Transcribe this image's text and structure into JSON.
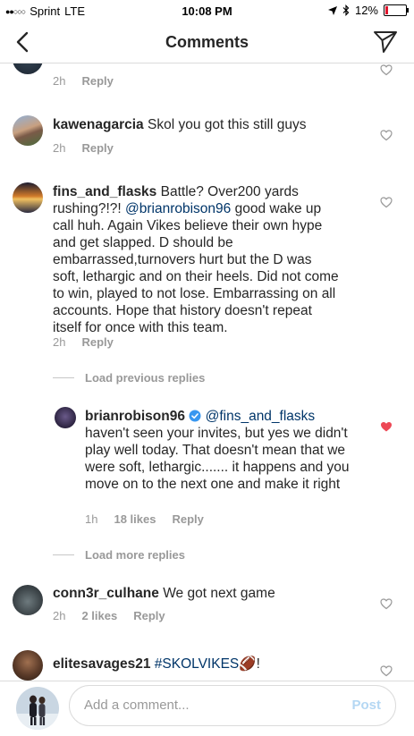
{
  "status_bar": {
    "signal": "●●○○○",
    "carrier": "Sprint",
    "network": "LTE",
    "time": "10:08 PM",
    "battery": "12%",
    "battery_color": "#e0142c"
  },
  "header": {
    "title": "Comments",
    "back_icon": "chevron-left-icon",
    "share_icon": "paper-plane-icon"
  },
  "comments": {
    "partial": {
      "time": "2h",
      "reply": "Reply"
    },
    "c1": {
      "username": "kawenagarcia",
      "text": "Skol you got this still guys",
      "time": "2h",
      "reply": "Reply"
    },
    "c2": {
      "username": "fins_and_flasks",
      "text_pre": "Battle? Over200 yards rushing?!?! ",
      "mention": "@brianrobison96",
      "text_post": " good wake up call huh. Again Vikes believe their own hype and get slapped. D should be embarrassed,turnovers hurt but the D was soft, lethargic and on their heels. Did not come to win, played to not lose. Embarrassing on all accounts. Hope that history doesn't repeat itself for once with this team.",
      "time": "2h",
      "reply": "Reply"
    },
    "load_previous": "Load previous replies",
    "reply1": {
      "username": "brianrobison96",
      "mention": "@fins_and_flasks",
      "text": " haven't seen your invites, but yes we didn't play well today. That doesn't mean that we were soft, lethargic....... it happens and you move on to the next one and make it right",
      "time": "1h",
      "likes": "18 likes",
      "reply": "Reply",
      "liked": true
    },
    "load_more": "Load more replies",
    "c3": {
      "username": "conn3r_culhane",
      "text": "We got next game",
      "time": "2h",
      "likes": "2 likes",
      "reply": "Reply"
    },
    "c4": {
      "username": "elitesavages21",
      "hashtag": "#SKOLVIKES",
      "emoji": "🏈",
      "suffix": "!"
    }
  },
  "composer": {
    "placeholder": "Add a comment...",
    "post_label": "Post"
  },
  "colors": {
    "mention": "#003569",
    "heart_liked": "#ed4956",
    "post_disabled": "#b4d7f3"
  }
}
